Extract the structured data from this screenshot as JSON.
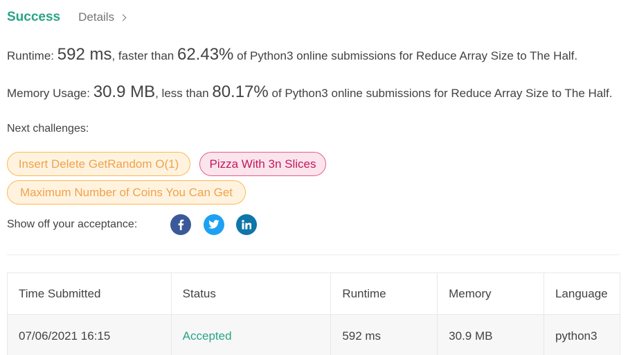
{
  "header": {
    "status": "Success",
    "details_label": "Details"
  },
  "runtime": {
    "label": "Runtime:",
    "value": "592 ms",
    "mid": ", faster than",
    "percent": "62.43%",
    "suffix": "of Python3 online submissions for Reduce Array Size to The Half."
  },
  "memory": {
    "label": "Memory Usage:",
    "value": "30.9 MB",
    "mid": ", less than",
    "percent": "80.17%",
    "suffix": "of Python3 online submissions for Reduce Array Size to The Half."
  },
  "next_challenges": {
    "label": "Next challenges:",
    "items": [
      {
        "label": "Insert Delete GetRandom O(1)",
        "difficulty": "medium",
        "color": "#ffb74d"
      },
      {
        "label": "Pizza With 3n Slices",
        "difficulty": "hard",
        "color": "#e35d8c"
      },
      {
        "label": "Maximum Number of Coins You Can Get",
        "difficulty": "medium",
        "color": "#ffb74d"
      }
    ]
  },
  "share": {
    "label": "Show off your acceptance:",
    "icons": [
      "facebook-icon",
      "twitter-icon",
      "linkedin-icon"
    ]
  },
  "table": {
    "headers": [
      "Time Submitted",
      "Status",
      "Runtime",
      "Memory",
      "Language"
    ],
    "rows": [
      [
        "07/06/2021 16:15",
        "Accepted",
        "592 ms",
        "30.9 MB",
        "python3"
      ]
    ]
  },
  "colors": {
    "accent": "#2aa386",
    "medium": "#ffb74d",
    "hard": "#e35d8c"
  }
}
